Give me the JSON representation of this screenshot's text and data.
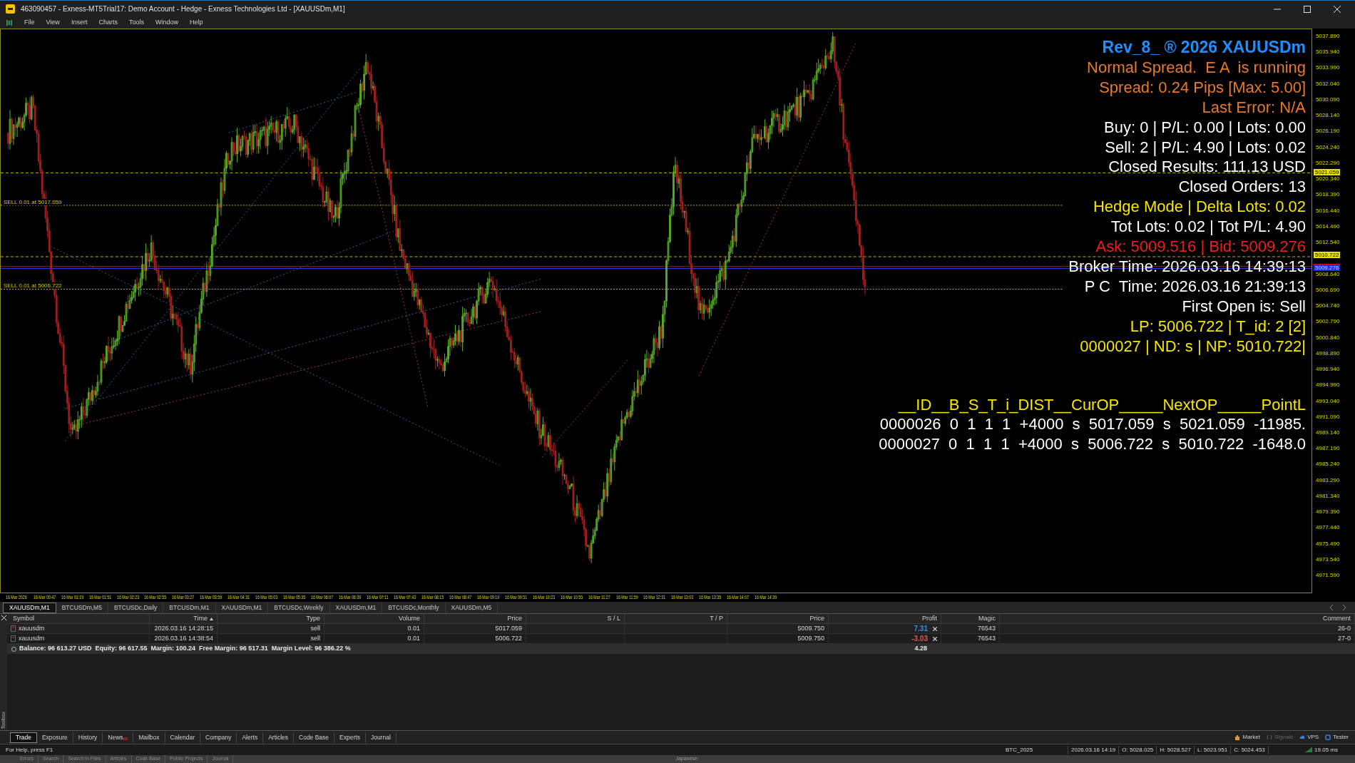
{
  "window": {
    "title": "463090457 - Exness-MT5Trial17: Demo Account - Hedge - Exness Technologies Ltd - [XAUUSDm,M1]"
  },
  "menu": [
    "File",
    "View",
    "Insert",
    "Charts",
    "Tools",
    "Window",
    "Help"
  ],
  "chart": {
    "order_labels": [
      "SELL 0.01 at 5017.059",
      "SELL 0.01 at 5006.722"
    ],
    "status_lines": [
      {
        "text": "Rev_8_ ® 2026 XAUUSDm",
        "color": "#1e8fff",
        "kind": "title"
      },
      {
        "text": "Normal Spread.  E A  is running",
        "color": "#e8792b",
        "kind": "line"
      },
      {
        "text": "Spread: 0.24 Pips [Max: 5.00]",
        "color": "#e8792b",
        "kind": "line"
      },
      {
        "text": "Last Error: N/A",
        "color": "#e8792b",
        "kind": "line"
      },
      {
        "text": "Buy: 0 | P/L: 0.00 | Lots: 0.00",
        "color": "#ffffff",
        "kind": "line"
      },
      {
        "text": "Sell: 2 | P/L: 4.90 | Lots: 0.02",
        "color": "#ffffff",
        "kind": "line"
      },
      {
        "text": "Closed Results: 111.13 USD",
        "color": "#ffffff",
        "kind": "line"
      },
      {
        "text": "Closed Orders: 13",
        "color": "#ffffff",
        "kind": "line"
      },
      {
        "text": "Hedge Mode | Delta Lots: 0.02",
        "color": "#f5e600",
        "kind": "line"
      },
      {
        "text": "Tot Lots: 0.02 | Tot P/L: 4.90",
        "color": "#ffffff",
        "kind": "line"
      },
      {
        "text": "Ask: 5009.516 | Bid: 5009.276",
        "color": "#f01c1c",
        "kind": "line"
      },
      {
        "text": "Broker Time: 2026.03.16 14:39:13",
        "color": "#ffffff",
        "kind": "line"
      },
      {
        "text": "P C  Time: 2026.03.16 21:39:13",
        "color": "#ffffff",
        "kind": "line"
      },
      {
        "text": "First Open is: Sell",
        "color": "#ffffff",
        "kind": "line"
      },
      {
        "text": "LP: 5006.722 | T_id: 2 [2]",
        "color": "#f5e600",
        "kind": "line"
      },
      {
        "text": "0000027 | ND: s | NP: 5010.722|",
        "color": "#f5e600",
        "kind": "line"
      }
    ],
    "order_table": [
      {
        "text": "__ID__B_S_T_i_DIST__CurOP_____NextOP_____PointL",
        "color": "#f5e600"
      },
      {
        "text": "0000026  0  1  1  1  +4000  s  5017.059  s  5021.059  -11985.",
        "color": "#ffffff"
      },
      {
        "text": "0000027  0  1  1  1  +4000  s  5006.722  s  5010.722  -1648.0",
        "color": "#ffffff"
      }
    ],
    "price_ticks": [
      "5037.890",
      "5035.940",
      "5033.990",
      "5032.040",
      "5030.090",
      "5028.140",
      "5026.190",
      "5024.240",
      "5022.290",
      "5020.340",
      "5018.390",
      "5016.440",
      "5014.490",
      "5012.540",
      "5008.640",
      "5006.690",
      "5004.740",
      "5002.790",
      "5000.840",
      "4998.890",
      "4996.940",
      "4994.990",
      "4993.040",
      "4991.090",
      "4989.140",
      "4987.190",
      "4985.240",
      "4983.290",
      "4981.340",
      "4979.390",
      "4977.440",
      "4975.490",
      "4973.540",
      "4971.590"
    ],
    "price_badges": [
      {
        "text": "5021.059",
        "kind": "line"
      },
      {
        "text": "5010.722",
        "kind": "line"
      },
      {
        "text": "5009.276",
        "kind": "bid"
      }
    ],
    "time_ticks": [
      "16 Mar 2026",
      "16 Mar 00:47",
      "16 Mar 01:19",
      "16 Mar 01:51",
      "16 Mar 02:23",
      "16 Mar 02:55",
      "16 Mar 03:27",
      "16 Mar 03:59",
      "16 Mar 04:31",
      "16 Mar 05:03",
      "16 Mar 05:35",
      "16 Mar 06:07",
      "16 Mar 06:39",
      "16 Mar 07:11",
      "16 Mar 07:43",
      "16 Mar 08:15",
      "16 Mar 08:47",
      "16 Mar 09:19",
      "16 Mar 09:51",
      "16 Mar 10:23",
      "16 Mar 10:55",
      "16 Mar 11:27",
      "16 Mar 11:59",
      "16 Mar 12:31",
      "16 Mar 13:03",
      "16 Mar 13:35",
      "16 Mar 14:07",
      "16 Mar 14:39"
    ]
  },
  "chart_tabs": [
    {
      "label": "XAUUSDm,M1",
      "selected": true
    },
    {
      "label": "BTCUSDm,M5",
      "selected": false
    },
    {
      "label": "BTCUSDc,Daily",
      "selected": false
    },
    {
      "label": "BTCUSDm,M1",
      "selected": false
    },
    {
      "label": "XAUUSDm,M1",
      "selected": false
    },
    {
      "label": "BTCUSDc,Weekly",
      "selected": false
    },
    {
      "label": "XAUUSDm,M1",
      "selected": false
    },
    {
      "label": "BTCUSDc,Monthly",
      "selected": false
    },
    {
      "label": "XAUUSDm,M5",
      "selected": false
    }
  ],
  "trade_table": {
    "columns": [
      "Symbol",
      "Time",
      "Type",
      "Volume",
      "Price",
      "S / L",
      "T / P",
      "Price",
      "Profit",
      "Magic",
      "Comment"
    ],
    "rows": [
      {
        "cells": [
          "xauusdm",
          "2026.03.16 14:28:15",
          "sell",
          "0.01",
          "5017.059",
          "",
          "",
          "5009.750",
          "7.31",
          "76543",
          "26-0"
        ],
        "color": "#3b8fdc"
      },
      {
        "cells": [
          "xauusdm",
          "2026.03.16 14:38:54",
          "sell",
          "0.01",
          "5006.722",
          "",
          "",
          "5009.750",
          "-3.03",
          "76543",
          "27-0"
        ],
        "color": "#e05a5a"
      }
    ],
    "balance": "Balance: 96 613.27 USD  Equity: 96 617.55  Margin: 100.24  Free Margin: 96 517.31  Margin Level: 96 386.22 %",
    "total_profit": "4.28"
  },
  "toolbox_label": "Toolbox",
  "bottom_tabs": [
    {
      "label": "Trade",
      "selected": true
    },
    {
      "label": "Exposure",
      "selected": false
    },
    {
      "label": "History",
      "selected": false
    },
    {
      "label": "News",
      "selected": false,
      "badge": "99"
    },
    {
      "label": "Mailbox",
      "selected": false
    },
    {
      "label": "Calendar",
      "selected": false
    },
    {
      "label": "Company",
      "selected": false
    },
    {
      "label": "Alerts",
      "selected": false
    },
    {
      "label": "Articles",
      "selected": false
    },
    {
      "label": "Code Base",
      "selected": false
    },
    {
      "label": "Experts",
      "selected": false
    },
    {
      "label": "Journal",
      "selected": false
    }
  ],
  "services": [
    {
      "label": "Market",
      "disabled": false
    },
    {
      "label": "Signals",
      "disabled": true
    },
    {
      "label": "VPS",
      "disabled": false
    },
    {
      "label": "Tester",
      "disabled": false
    }
  ],
  "status_bar": {
    "help": "For Help, press F1",
    "profile": "BTC_2025",
    "time": "2026.03.16 14:19",
    "open": "O: 5028.025",
    "high": "H: 5028.527",
    "low": "L: 5023.951",
    "close": "C: 5024.453",
    "ping": "19.05 ms"
  },
  "background_window": {
    "tabs": [
      "Errors",
      "Search",
      "Search in Files",
      "Articles",
      "Code Base",
      "Public Projects",
      "Journal"
    ],
    "label": "Japanese:"
  }
}
